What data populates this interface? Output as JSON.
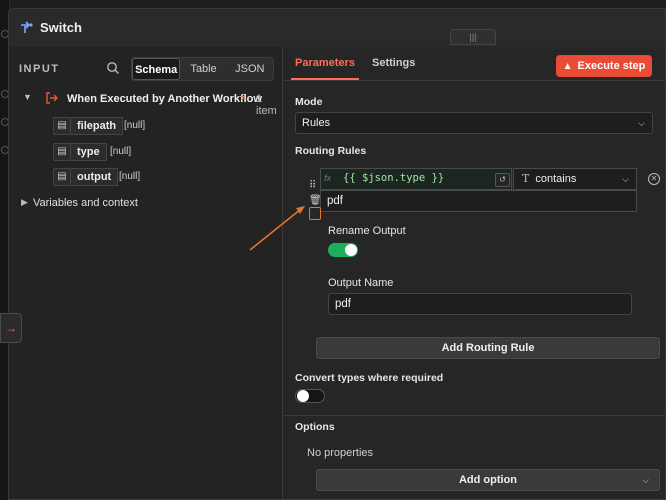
{
  "window": {
    "title": "Switch"
  },
  "input_panel": {
    "label": "INPUT",
    "view_tabs": [
      "Schema",
      "Table",
      "JSON"
    ],
    "node": {
      "name": "When Executed by Another Workflow",
      "count": "1 item"
    },
    "fields": [
      {
        "name": "filepath",
        "value": "[null]"
      },
      {
        "name": "type",
        "value": "[null]"
      },
      {
        "name": "output",
        "value": "[null]"
      }
    ],
    "variables": "Variables and context"
  },
  "params": {
    "tabs": {
      "parameters": "Parameters",
      "settings": "Settings"
    },
    "execute": "Execute step",
    "mode_label": "Mode",
    "mode_value": "Rules",
    "routing_label": "Routing Rules",
    "rule": {
      "expression": "{{ $json.type }}",
      "operator": "contains",
      "value": "pdf"
    },
    "rename_output_label": "Rename Output",
    "rename_output_on": true,
    "output_name_label": "Output Name",
    "output_name_value": "pdf",
    "add_rule": "Add Routing Rule",
    "convert_label": "Convert types where required",
    "convert_on": false,
    "options_label": "Options",
    "no_properties": "No properties",
    "add_option": "Add option"
  },
  "colors": {
    "accent": "#ff6d5a",
    "execute": "#ea4b34",
    "toggle_on": "#1fae5b",
    "annotation": "#e8742a"
  }
}
